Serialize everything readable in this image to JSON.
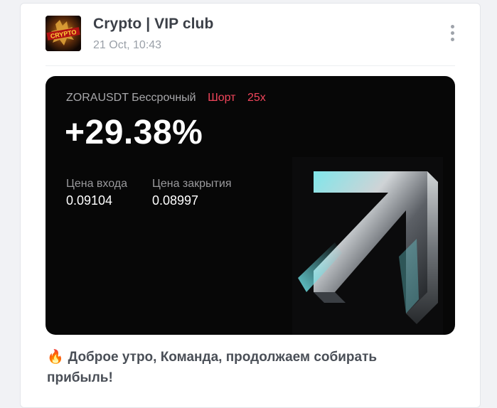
{
  "post": {
    "channel_name": "Crypto | VIP club",
    "date": "21 Oct, 10:43",
    "avatar_text": "CRYPTO",
    "text": "Доброе утро, Команда, продолжаем собирать прибыль!",
    "emoji": "🔥"
  },
  "trade_card": {
    "pair": "ZORAUSDT Бессрочный",
    "direction": "Шорт",
    "leverage": "25x",
    "pnl": "+29.38%",
    "entry_label": "Цена входа",
    "entry_value": "0.09104",
    "close_label": "Цена закрытия",
    "close_value": "0.08997"
  },
  "colors": {
    "short": "#f0455b",
    "card_bg": "#070707",
    "accent_cyan": "#6fe3e8"
  },
  "icons": [
    "more-vertical-icon",
    "arrow-up-right-icon",
    "fire-icon"
  ]
}
